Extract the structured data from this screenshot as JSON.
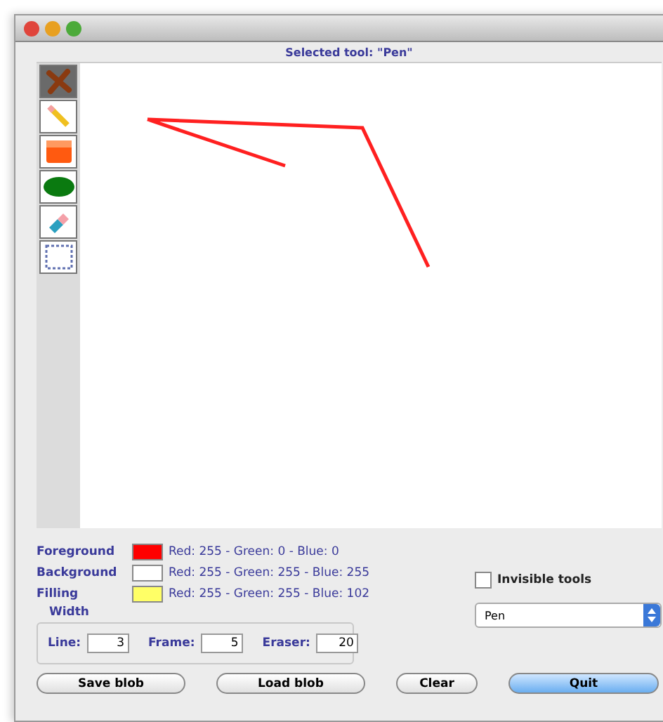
{
  "status_label": "Selected tool: \"Pen\"",
  "tools": [
    {
      "kind": "cross",
      "selected": true
    },
    {
      "kind": "pencil",
      "selected": false
    },
    {
      "kind": "rectangle",
      "selected": false
    },
    {
      "kind": "ellipse",
      "selected": false
    },
    {
      "kind": "eraser",
      "selected": false
    },
    {
      "kind": "selection",
      "selected": false
    }
  ],
  "colors": [
    {
      "label": "Foreground",
      "color": "#ff0000",
      "value": "Red: 255 - Green: 0 - Blue: 0"
    },
    {
      "label": "Background",
      "color": "#ffffff",
      "value": "Red: 255 - Green: 255 - Blue: 255"
    },
    {
      "label": "Filling",
      "color": "#ffff66",
      "value": "Red: 255 - Green: 255 - Blue: 102"
    }
  ],
  "invisible_tools": {
    "label": "Invisible tools",
    "checked": false
  },
  "tool_select": {
    "value": "Pen"
  },
  "width": {
    "title": "Width",
    "fields": [
      {
        "label": "Line:",
        "value": "3"
      },
      {
        "label": "Frame:",
        "value": "5"
      },
      {
        "label": "Eraser:",
        "value": "20"
      }
    ]
  },
  "buttons": [
    {
      "label": "Save blob",
      "default": false
    },
    {
      "label": "Load blob",
      "default": false
    },
    {
      "label": "Clear",
      "default": false
    },
    {
      "label": "Quit",
      "default": true
    }
  ]
}
